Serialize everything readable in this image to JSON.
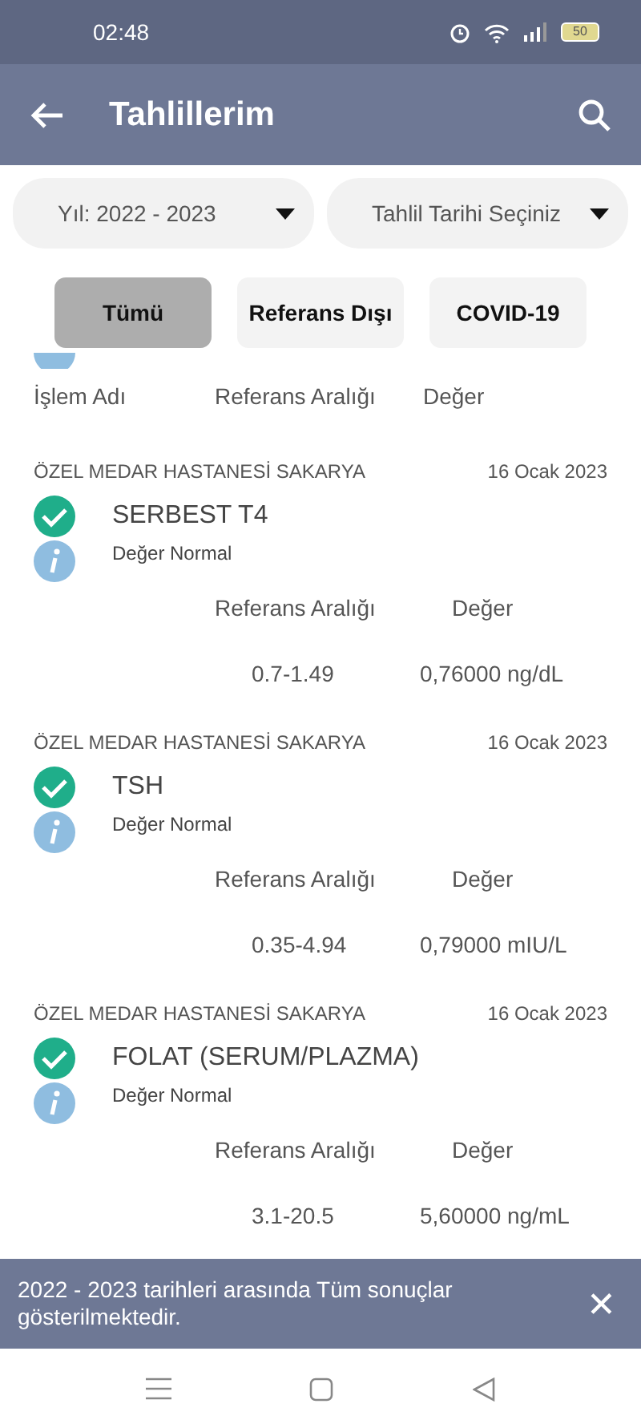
{
  "status_bar": {
    "time": "02:48",
    "battery": "50"
  },
  "app_bar": {
    "title": "Tahlillerim"
  },
  "filters": [
    {
      "label": "Yıl: 2022 - 2023"
    },
    {
      "label": "Tahlil Tarihi Seçiniz"
    }
  ],
  "chips": [
    {
      "label": "Tümü",
      "selected": true
    },
    {
      "label": "Referans Dışı",
      "selected": false
    },
    {
      "label": "COVID-19",
      "selected": false
    }
  ],
  "previous_row": {
    "columns": [
      "İşlem Adı",
      "Referans Aralığı",
      "Değer"
    ]
  },
  "results": [
    {
      "hospital": "ÖZEL MEDAR HASTANESİ SAKARYA",
      "date": "16 Ocak 2023",
      "test": "SERBEST T4",
      "status": "Değer Normal",
      "normal": true,
      "range_label": "Referans Aralığı",
      "value_label": "Değer",
      "range": "0.7-1.49",
      "value": "0,76000 ng/dL"
    },
    {
      "hospital": "ÖZEL MEDAR HASTANESİ SAKARYA",
      "date": "16 Ocak 2023",
      "test": "TSH",
      "status": "Değer Normal",
      "normal": true,
      "range_label": "Referans Aralığı",
      "value_label": "Değer",
      "range": "0.35-4.94",
      "value": "0,79000 mIU/L"
    },
    {
      "hospital": "ÖZEL MEDAR HASTANESİ SAKARYA",
      "date": "16 Ocak 2023",
      "test": "FOLAT (SERUM/PLAZMA)",
      "status": "Değer Normal",
      "normal": true,
      "range_label": "Referans Aralığı",
      "value_label": "Değer",
      "range": "3.1-20.5",
      "value": "5,60000 ng/mL"
    }
  ],
  "snackbar": {
    "message": "2022 - 2023 tarihleri arasında Tüm sonuçlar gösterilmektedir.",
    "close": "✕"
  }
}
